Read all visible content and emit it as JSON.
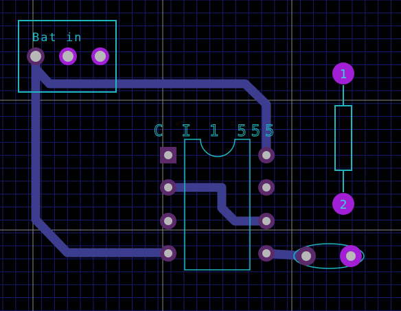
{
  "colors": {
    "background": "#000000",
    "grid_fine": "#1a1a6e",
    "grid_major": "#8a8a8a",
    "trace": "#3d3d8f",
    "silkscreen": "#1fb7bf",
    "pad_purple": "#a21fd6",
    "pad_dark": "#5a2a6a",
    "pad_center": "#b8b8b8",
    "pad_number_text": "#3fd0dc"
  },
  "board": {
    "battery_connector": {
      "label": "Bat in"
    },
    "ic": {
      "label": "C I 1 555"
    },
    "resistor": {
      "pad1_label": "1",
      "pad2_label": "2"
    }
  }
}
